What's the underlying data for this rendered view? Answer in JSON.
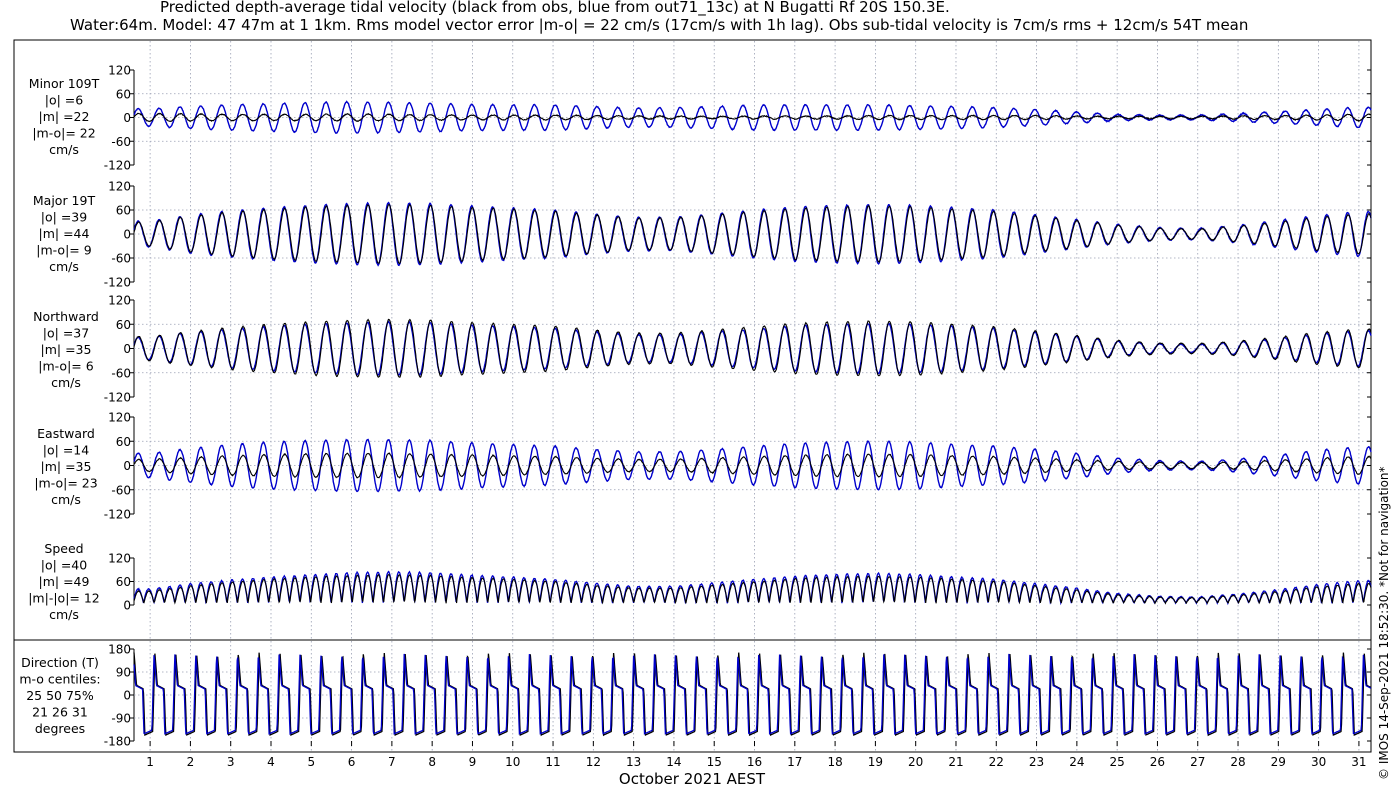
{
  "chart_data": {
    "type": "line",
    "title": "Predicted depth-average tidal velocity (black from obs, blue from out71_13c) at N Bugatti Rf 20S 150.3E.",
    "subtitle": "Water:64m. Model: 47 47m at 1 1km. Rms model vector error |m-o| = 22 cm/s (17cm/s with 1h lag). Obs sub-tidal velocity is 7cm/s rms + 12cm/s 54T mean",
    "xlabel": "October 2021 AEST",
    "x_ticks": [
      "1",
      "2",
      "3",
      "4",
      "5",
      "6",
      "7",
      "8",
      "9",
      "10",
      "11",
      "12",
      "13",
      "14",
      "15",
      "16",
      "17",
      "18",
      "19",
      "20",
      "21",
      "22",
      "23",
      "24",
      "25",
      "26",
      "27",
      "28",
      "29",
      "30",
      "31"
    ],
    "xlim": [
      0.6,
      31.3
    ],
    "colors": {
      "obs": "#000000",
      "model": "#0000cc",
      "grid": "#9aa0b4"
    },
    "series_legend": {
      "obs": "black from obs",
      "model": "blue from out71_13c"
    },
    "watermark": "© IMOS 14-Sep-2021 18:52:30. *Not for navigation*",
    "panels": [
      {
        "name": "minor",
        "label": [
          "Minor 109T",
          "|o| =6",
          "|m| =22",
          "|m-o|= 22",
          "cm/s"
        ],
        "ylim": [
          -120,
          120
        ],
        "y_ticks": [
          "120",
          "60",
          "0",
          "-60",
          "-120"
        ],
        "obs_amp": [
          10,
          9,
          8,
          8,
          8,
          9,
          8,
          7,
          6,
          6,
          6,
          5,
          4,
          4,
          3,
          4,
          4,
          4,
          5,
          5,
          5,
          5,
          5,
          4,
          3,
          3,
          3,
          4,
          5,
          6,
          8
        ],
        "model_amp": [
          22,
          28,
          32,
          35,
          38,
          40,
          38,
          36,
          33,
          32,
          32,
          28,
          24,
          25,
          28,
          32,
          32,
          32,
          32,
          30,
          28,
          25,
          20,
          14,
          8,
          6,
          6,
          10,
          15,
          20,
          26
        ]
      },
      {
        "name": "major",
        "label": [
          "Major 19T",
          "|o| =39",
          "|m| =44",
          "|m-o|= 9",
          "cm/s"
        ],
        "ylim": [
          -120,
          120
        ],
        "y_ticks": [
          "120",
          "60",
          "0",
          "-60",
          "-120"
        ],
        "obs_amp": [
          30,
          45,
          55,
          62,
          68,
          72,
          74,
          72,
          66,
          62,
          57,
          48,
          40,
          40,
          48,
          56,
          64,
          68,
          70,
          68,
          62,
          56,
          45,
          34,
          22,
          15,
          12,
          20,
          30,
          42,
          50
        ],
        "model_amp": [
          32,
          48,
          58,
          66,
          72,
          76,
          78,
          76,
          70,
          65,
          60,
          50,
          42,
          42,
          50,
          60,
          68,
          72,
          74,
          72,
          66,
          60,
          48,
          36,
          24,
          16,
          14,
          22,
          34,
          46,
          56
        ]
      },
      {
        "name": "northward",
        "label": [
          "Northward",
          "|o| =37",
          "|m| =35",
          "|m-o|= 6",
          "cm/s"
        ],
        "ylim": [
          -120,
          120
        ],
        "y_ticks": [
          "120",
          "60",
          "0",
          "-60",
          "-120"
        ],
        "obs_amp": [
          30,
          42,
          52,
          60,
          66,
          70,
          72,
          70,
          64,
          60,
          56,
          46,
          38,
          38,
          46,
          54,
          62,
          66,
          68,
          66,
          60,
          54,
          43,
          32,
          20,
          14,
          12,
          18,
          28,
          40,
          48
        ],
        "model_amp": [
          28,
          40,
          48,
          55,
          60,
          64,
          66,
          64,
          58,
          54,
          50,
          42,
          34,
          34,
          42,
          48,
          56,
          60,
          62,
          60,
          55,
          50,
          40,
          30,
          18,
          12,
          10,
          16,
          25,
          36,
          44
        ]
      },
      {
        "name": "eastward",
        "label": [
          "Eastward",
          "|o| =14",
          "|m| =35",
          "|m-o|= 23",
          "cm/s"
        ],
        "ylim": [
          -120,
          120
        ],
        "y_ticks": [
          "120",
          "60",
          "0",
          "-60",
          "-120"
        ],
        "obs_amp": [
          15,
          20,
          24,
          27,
          29,
          30,
          30,
          28,
          26,
          24,
          22,
          18,
          15,
          15,
          18,
          22,
          25,
          27,
          28,
          27,
          24,
          22,
          18,
          14,
          10,
          8,
          7,
          9,
          13,
          18,
          22
        ],
        "model_amp": [
          30,
          42,
          52,
          58,
          62,
          64,
          64,
          62,
          56,
          52,
          48,
          40,
          34,
          34,
          40,
          48,
          55,
          58,
          60,
          58,
          52,
          48,
          40,
          30,
          18,
          12,
          10,
          16,
          26,
          38,
          46
        ]
      },
      {
        "name": "speed",
        "label": [
          "Speed",
          "|o| =40",
          "|m| =49",
          "|m|-|o|= 12",
          "cm/s"
        ],
        "ylim": [
          0,
          120
        ],
        "y_ticks": [
          "120",
          "60",
          "0"
        ],
        "obs_amp": [
          32,
          46,
          56,
          64,
          70,
          74,
          76,
          74,
          68,
          64,
          58,
          48,
          40,
          40,
          48,
          57,
          66,
          70,
          72,
          70,
          64,
          58,
          46,
          35,
          22,
          16,
          14,
          21,
          31,
          44,
          52
        ],
        "model_amp": [
          38,
          52,
          62,
          70,
          76,
          82,
          84,
          82,
          75,
          70,
          64,
          54,
          45,
          45,
          54,
          64,
          72,
          77,
          80,
          77,
          70,
          64,
          52,
          40,
          26,
          18,
          16,
          24,
          36,
          50,
          60
        ]
      },
      {
        "name": "direction",
        "label": [
          "Direction (T)",
          "m-o centiles:",
          "25  50  75%",
          "21  26  31",
          "degrees"
        ],
        "ylim": [
          -180,
          180
        ],
        "y_ticks": [
          "180",
          "90",
          "0",
          "-90",
          "-180"
        ]
      }
    ]
  }
}
